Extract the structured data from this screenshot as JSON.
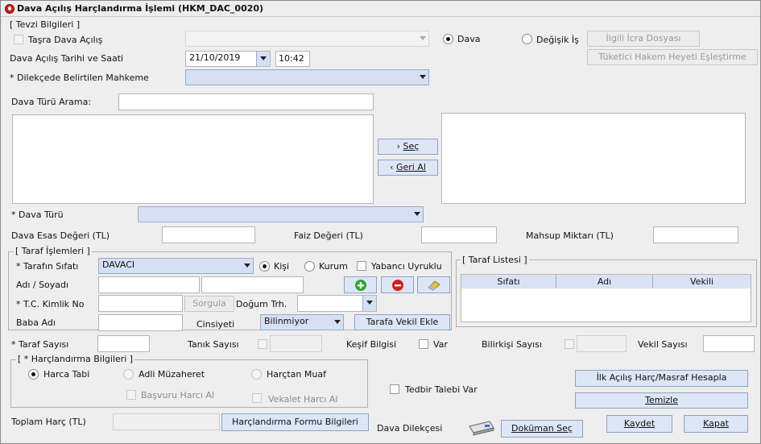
{
  "window": {
    "title": "Dava Açılış Harçlandırma İşlemi (HKM_DAC_0020)"
  },
  "tevzi": {
    "group_label": "[ Tevzi Bilgileri ]",
    "tasra_label": "Taşra Dava Açılış",
    "radio_dava": "Dava",
    "radio_degisik": "Değişik İş",
    "icra_button": "İlgili İcra Dosyası",
    "tuketici_button": "Tüketici Hakem Heyeti Eşleştirme",
    "tarih_label": "Dava Açılış Tarihi ve Saati",
    "tarih_value": "21/10/2019",
    "saat_value": "10:42",
    "mahkeme_label": "* Dilekçede Belirtilen Mahkeme",
    "mahkeme_value": ""
  },
  "dava_turu": {
    "arama_label": "Dava Türü Arama:",
    "arama_value": "",
    "sec_button": "Seç",
    "geri_button": "Geri Al",
    "tur_label": "* Dava Türü",
    "tur_value": ""
  },
  "degerler": {
    "esas_label": "Dava Esas Değeri (TL)",
    "faiz_label": "Faiz Değeri (TL)",
    "mahsup_label": "Mahsup Miktarı (TL)"
  },
  "taraf": {
    "group_label": "[ Taraf İşlemleri ]",
    "sifat_label": "* Tarafın Sıfatı",
    "sifat_value": "DAVACI",
    "radio_kisi": "Kişi",
    "radio_kurum": "Kurum",
    "yabanci_label": "Yabancı Uyruklu",
    "adsoyad_label": "Adı / Soyadı",
    "tc_label": "* T.C. Kimlik No",
    "sorgula_button": "Sorgula",
    "dogum_label": "Doğum Trh.",
    "baba_label": "Baba Adı",
    "cinsiyet_label": "Cinsiyeti",
    "cinsiyet_value": "Bilinmiyor",
    "vekil_button": "Tarafa Vekil Ekle"
  },
  "taraf_listesi": {
    "group_label": "[ Taraf Listesi ]",
    "columns": [
      "Sıfatı",
      "Adı",
      "Vekili"
    ]
  },
  "sayilar": {
    "taraf_label": "* Taraf Sayısı",
    "tanik_label": "Tanık Sayısı",
    "kesif_label": "Keşif Bilgisi",
    "var_label": "Var",
    "bilirkisi_label": "Bilirkişi Sayısı",
    "vekil_label": "Vekil Sayısı"
  },
  "harclandirma": {
    "group_label": "[ * Harçlandırma Bilgileri ]",
    "harca_tabi": "Harca Tabi",
    "adli_muzaheret": "Adli Müzaheret",
    "harctan_muaf": "Harçtan Muaf",
    "basvuru_harci": "Başvuru Harcı Al",
    "vekalet_harci": "Vekalet Harcı Al",
    "tedbir_label": "Tedbir Talebi Var",
    "ilk_acilis_button": "İlk Açılış Harç/Masraf Hesapla",
    "temizle_button": "Temizle"
  },
  "footer": {
    "toplam_label": "Toplam Harç (TL)",
    "form_button": "Harçlandırma Formu Bilgileri",
    "dilekce_label": "Dava Dilekçesi",
    "dokuman_button": "Doküman Seç",
    "kaydet_button": "Kaydet",
    "kapat_button": "Kapat"
  }
}
